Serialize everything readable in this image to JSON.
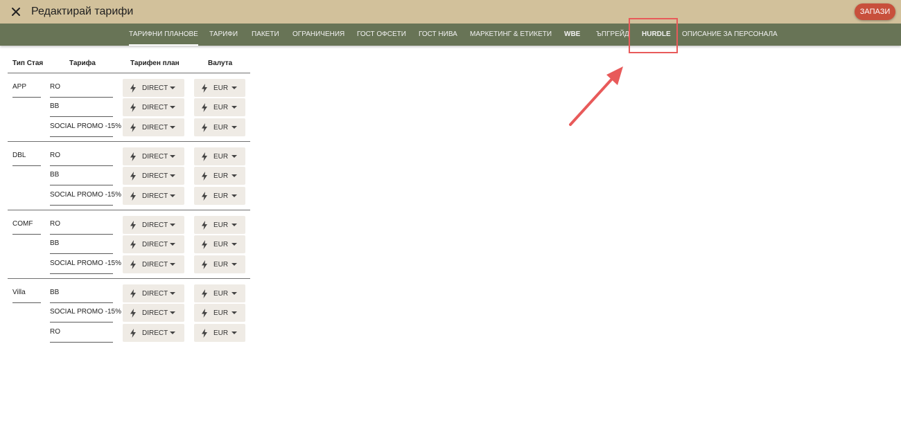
{
  "header": {
    "title": "Редактирай тарифи",
    "save_label": "ЗАПАЗИ"
  },
  "tabs": [
    {
      "label": "ТАРИФНИ ПЛАНОВЕ",
      "active": true,
      "bold": false
    },
    {
      "label": "ТАРИФИ",
      "active": false,
      "bold": false
    },
    {
      "label": "ПАКЕТИ",
      "active": false,
      "bold": false
    },
    {
      "label": "ОГРАНИЧЕНИЯ",
      "active": false,
      "bold": false
    },
    {
      "label": "ГОСТ ОФСЕТИ",
      "active": false,
      "bold": false
    },
    {
      "label": "ГОСТ НИВА",
      "active": false,
      "bold": false
    },
    {
      "label": "МАРКЕТИНГ & ЕТИКЕТИ",
      "active": false,
      "bold": false
    },
    {
      "label": "WBE",
      "active": false,
      "bold": true
    },
    {
      "label": "ЪПГРЕЙД",
      "active": false,
      "bold": false
    },
    {
      "label": "HURDLE",
      "active": false,
      "bold": true
    },
    {
      "label": "ОПИСАНИЕ ЗА ПЕРСОНАЛА",
      "active": false,
      "bold": false
    }
  ],
  "table": {
    "headers": [
      "Тип Стая",
      "Тарифа",
      "Тарифен план",
      "Валута"
    ],
    "groups": [
      {
        "room": "APP",
        "rows": [
          {
            "rate": "RO",
            "plan": "DIRECT",
            "currency": "EUR"
          },
          {
            "rate": "BB",
            "plan": "DIRECT",
            "currency": "EUR"
          },
          {
            "rate": "SOCIAL PROMO -15%",
            "plan": "DIRECT",
            "currency": "EUR"
          }
        ]
      },
      {
        "room": "DBL",
        "rows": [
          {
            "rate": "RO",
            "plan": "DIRECT",
            "currency": "EUR"
          },
          {
            "rate": "BB",
            "plan": "DIRECT",
            "currency": "EUR"
          },
          {
            "rate": "SOCIAL PROMO -15%",
            "plan": "DIRECT",
            "currency": "EUR"
          }
        ]
      },
      {
        "room": "COMF",
        "rows": [
          {
            "rate": "RO",
            "plan": "DIRECT",
            "currency": "EUR"
          },
          {
            "rate": "BB",
            "plan": "DIRECT",
            "currency": "EUR"
          },
          {
            "rate": "SOCIAL PROMO -15%",
            "plan": "DIRECT",
            "currency": "EUR"
          }
        ]
      },
      {
        "room": "Villa",
        "rows": [
          {
            "rate": "BB",
            "plan": "DIRECT",
            "currency": "EUR"
          },
          {
            "rate": "SOCIAL PROMO -15%",
            "plan": "DIRECT",
            "currency": "EUR"
          },
          {
            "rate": "RO",
            "plan": "DIRECT",
            "currency": "EUR"
          }
        ]
      }
    ]
  },
  "annotation": {
    "color": "#e85a5a",
    "target": "HURDLE"
  },
  "colors": {
    "topbar": "#d2c19b",
    "navbar": "#687456",
    "save": "#c8503c",
    "chip": "#efebe5"
  }
}
